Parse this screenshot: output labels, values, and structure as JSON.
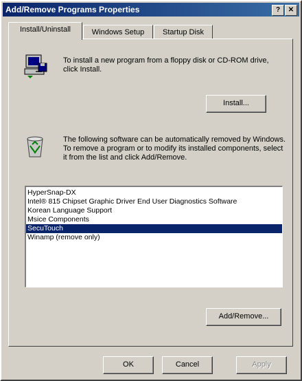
{
  "window": {
    "title": "Add/Remove Programs Properties",
    "help_label": "?",
    "close_label": "✕"
  },
  "tabs": [
    {
      "label": "Install/Uninstall",
      "active": true
    },
    {
      "label": "Windows Setup",
      "active": false
    },
    {
      "label": "Startup Disk",
      "active": false
    }
  ],
  "install_section": {
    "icon": "computer-floppy-icon",
    "text": "To install a new program from a floppy disk or CD-ROM drive, click Install.",
    "button_label": "Install..."
  },
  "remove_section": {
    "icon": "recycle-icon",
    "text": "The following software can be automatically removed by Windows. To remove a program or to modify its installed components, select it from the list and click Add/Remove.",
    "programs": [
      "HyperSnap-DX",
      "Intel® 815 Chipset Graphic Driver End User Diagnostics Software",
      "Korean Language Support",
      "Msice Components",
      "SecuTouch",
      "Winamp (remove only)"
    ],
    "selected_index": 4,
    "button_label": "Add/Remove..."
  },
  "footer": {
    "ok_label": "OK",
    "cancel_label": "Cancel",
    "apply_label": "Apply"
  },
  "colors": {
    "title_bar": "#0a246a",
    "selection": "#0a246a",
    "face": "#d4d0c8"
  }
}
